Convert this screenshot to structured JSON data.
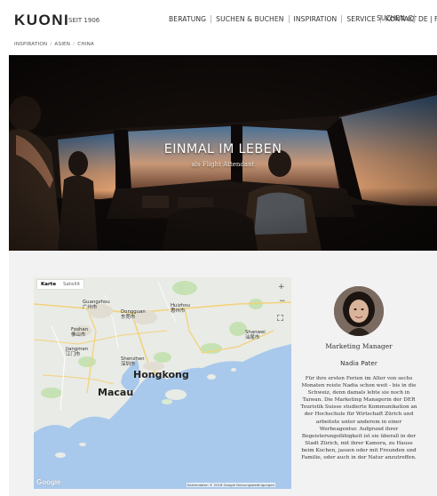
{
  "header": {
    "logo": "KUONI",
    "logo_since": "SEIT 1906",
    "nav": [
      "BERATUNG",
      "SUCHEN & BUCHEN",
      "INSPIRATION",
      "SERVICE",
      "KONTAKT"
    ],
    "search_label": "SUCHEN",
    "lang": "DE | FR"
  },
  "breadcrumb": [
    "INSPIRATION",
    "ASIEN",
    "CHINA"
  ],
  "hero": {
    "title": "EINMAL IM LEBEN",
    "subtitle": "als Flight Attendant"
  },
  "map": {
    "tab_map": "Karte",
    "tab_sat": "Satellit",
    "zoom_in": "+",
    "zoom_out": "−",
    "labels": {
      "guangzhou": "Guangzhou\n广州市",
      "dongguan": "Dongguan\n东莞市",
      "huizhou": "Huizhou\n惠州市",
      "foshan": "Foshan\n佛山市",
      "jiangmen": "Jiangmen\n江门市",
      "shenzhen": "Shenzhen\n深圳市",
      "shanwei": "Shanwei\n汕尾市",
      "hongkong": "Hongkong",
      "macau": "Macau"
    },
    "google": "Google",
    "attribution": "Kartendaten © 2018 Google   Nutzungsbedingungen"
  },
  "profile": {
    "role": "Marketing Manager",
    "name": "Nadia Pater",
    "bio": "Für ihre ersten Ferien im Alter von sechs Monaten reiste Nadia schon weit - bis in die Schweiz, denn damals lebte sie noch in Taiwan. Die Marketing Managerin der DER Touristik Suisse studierte Kommunikation an der Hochschule für Wirtschaft Zürich und arbeitete unter anderem in einer Werbeagentur. Aufgrund ihrer Begeisterungsfähigkeit ist sie überall in der Stadt Zürich, mit ihrer Kamera, zu Hause beim Kochen, jassen oder mit Freunden und Familie, oder auch in der Natur anzutreffen."
  },
  "colors": {
    "sea": "#a9c9ec",
    "land": "#e9ebe6",
    "park": "#c6e2b4",
    "road": "#f3d27a",
    "band": "#f2f2f2"
  }
}
